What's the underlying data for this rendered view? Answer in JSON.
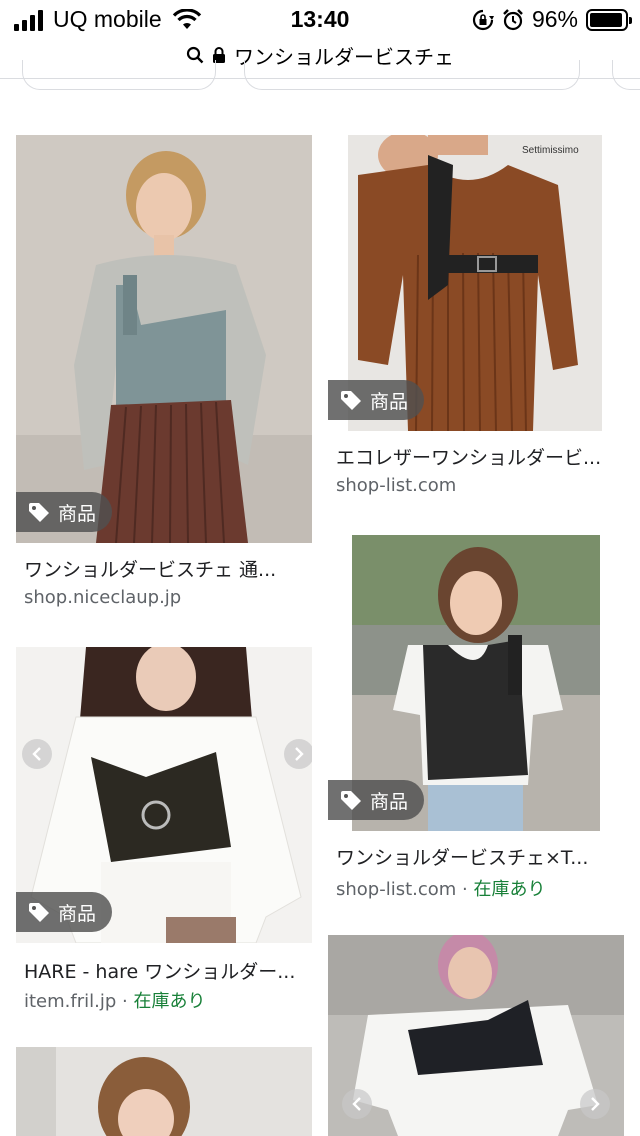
{
  "status_bar": {
    "carrier": "UQ mobile",
    "time": "13:40",
    "battery": "96%"
  },
  "url_bar": {
    "query": "ワンショルダービスチェ"
  },
  "colors": {
    "stock_green": "#188038",
    "source_gray": "#5f6368",
    "badge_bg": "#505050"
  },
  "results": [
    {
      "badge": "商品",
      "title": "ワンショルダービスチェ 通...",
      "source": "shop.niceclaup.jp",
      "stock": ""
    },
    {
      "badge": "商品",
      "title": "エコレザーワンショルダービ...",
      "source": "shop-list.com",
      "stock": "",
      "watermark": "Settimissimo"
    },
    {
      "badge": "商品",
      "title": "ワンショルダービスチェ×T...",
      "source": "shop-list.com",
      "separator": " · ",
      "stock": "在庫あり"
    },
    {
      "badge": "商品",
      "title": "HARE - hare ワンショルダー...",
      "source": "item.fril.jp",
      "separator": " · ",
      "stock": "在庫あり"
    }
  ]
}
